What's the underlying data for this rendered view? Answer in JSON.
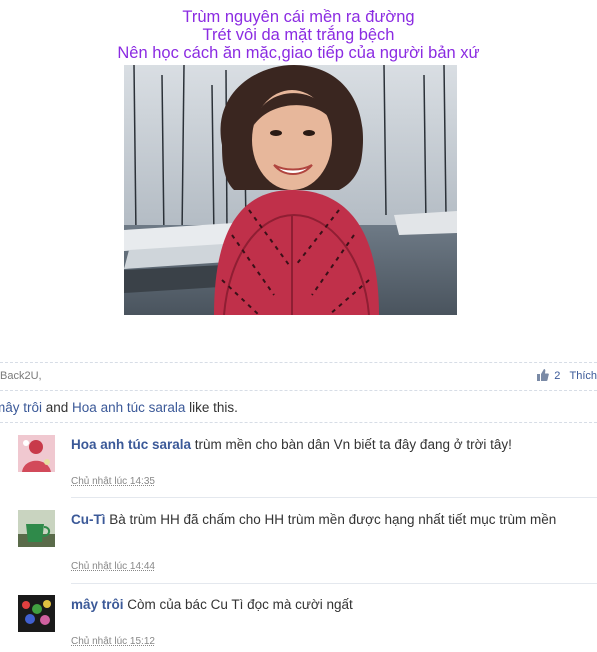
{
  "caption": {
    "line1": "Trùm nguyên cái mền ra đường",
    "line2": "Trét vôi da mặt trắng bệch",
    "line3": "Nên học cách ăn mặc,giao tiếp của người bản xứ"
  },
  "post_meta": {
    "author": "Back2U,",
    "like_count": "2",
    "like_label": "Thích"
  },
  "likes": {
    "user1": "mây trôi",
    "and": " and ",
    "user2": "Hoa anh túc sarala",
    "suffix": " like this."
  },
  "comments": [
    {
      "name": "Hoa anh túc sarala",
      "text": " trùm mền cho bàn dân Vn biết ta đây đang ở trời tây!",
      "time": "Chủ nhật lúc 14:35"
    },
    {
      "name": "Cu-Tì",
      "text": " Bà trùm HH đã chấm cho HH trùm mền được hạng nhất tiết mục trùm mền",
      "time": "Chủ nhật lúc 14:44"
    },
    {
      "name": "mây trôi",
      "text": " Còm của bác Cu Tì đọc mà cười ngất",
      "time": "Chủ nhật lúc 15:12"
    }
  ],
  "colors": {
    "caption": "#8b2be2",
    "link": "#3b5998",
    "scarf": "#c0304a"
  }
}
